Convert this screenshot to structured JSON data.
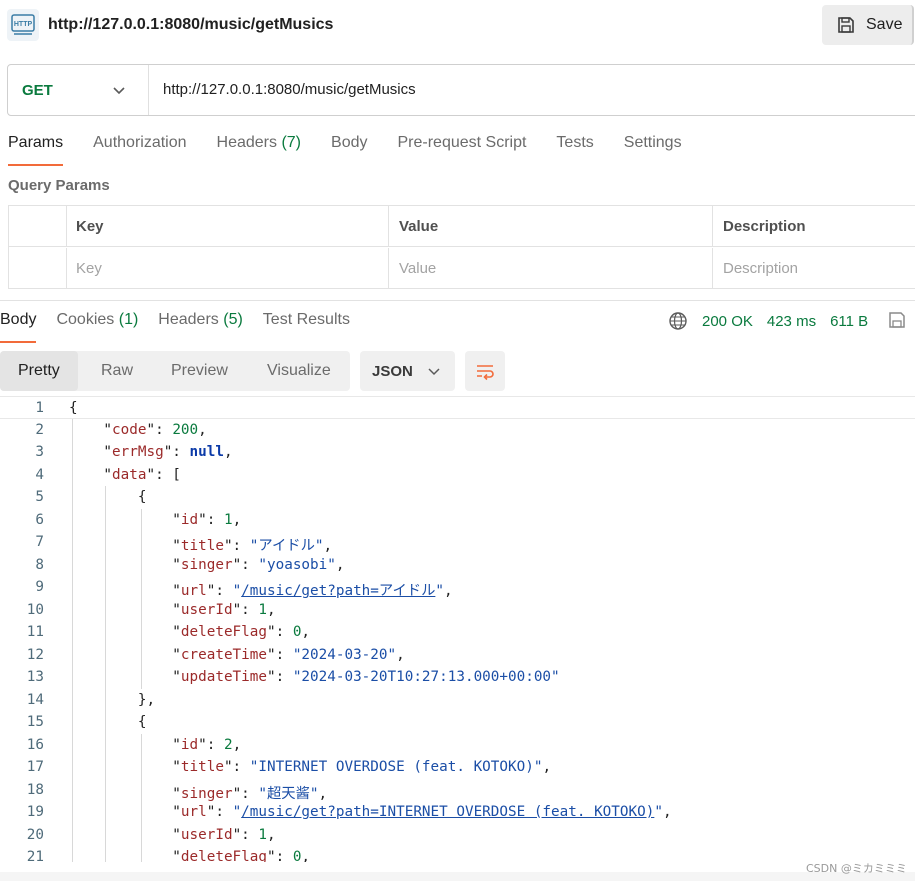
{
  "header": {
    "icon": "http-icon",
    "title": "http://127.0.0.1:8080/music/getMusics",
    "save_label": "Save"
  },
  "request": {
    "method": "GET",
    "url": "http://127.0.0.1:8080/music/getMusics",
    "tabs": [
      {
        "label": "Params",
        "count": "",
        "active": true
      },
      {
        "label": "Authorization",
        "count": ""
      },
      {
        "label": "Headers",
        "count": "(7)"
      },
      {
        "label": "Body",
        "count": ""
      },
      {
        "label": "Pre-request Script",
        "count": ""
      },
      {
        "label": "Tests",
        "count": ""
      },
      {
        "label": "Settings",
        "count": ""
      }
    ],
    "query_params_label": "Query Params",
    "table": {
      "headers": [
        "Key",
        "Value",
        "Description"
      ],
      "placeholders": [
        "Key",
        "Value",
        "Description"
      ]
    }
  },
  "response": {
    "tabs": [
      {
        "label": "Body",
        "count": "",
        "active": true
      },
      {
        "label": "Cookies",
        "count": "(1)"
      },
      {
        "label": "Headers",
        "count": "(5)"
      },
      {
        "label": "Test Results",
        "count": ""
      }
    ],
    "status": "200 OK",
    "time": "423 ms",
    "size": "611 B",
    "views": [
      "Pretty",
      "Raw",
      "Preview",
      "Visualize"
    ],
    "format": "JSON"
  },
  "code_lines": [
    "{",
    "    \"code\": 200,",
    "    \"errMsg\": null,",
    "    \"data\": [",
    "        {",
    "            \"id\": 1,",
    "            \"title\": \"アイドル\",",
    "            \"singer\": \"yoasobi\",",
    "            \"url\": \"/music/get?path=アイドル\",",
    "            \"userId\": 1,",
    "            \"deleteFlag\": 0,",
    "            \"createTime\": \"2024-03-20\",",
    "            \"updateTime\": \"2024-03-20T10:27:13.000+00:00\"",
    "        },",
    "        {",
    "            \"id\": 2,",
    "            \"title\": \"INTERNET OVERDOSE (feat. KOTOKO)\",",
    "            \"singer\": \"超天酱\",",
    "            \"url\": \"/music/get?path=INTERNET OVERDOSE (feat. KOTOKO)\",",
    "            \"userId\": 1,",
    "            \"deleteFlag\": 0,"
  ],
  "watermark": "CSDN @ミカミミミ"
}
